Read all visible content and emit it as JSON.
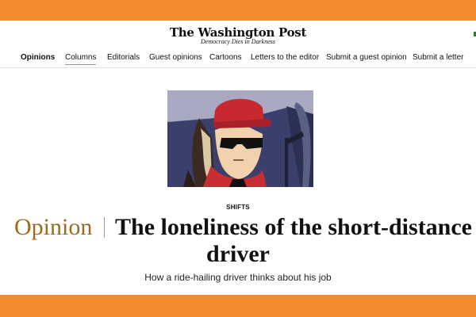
{
  "masthead": {
    "logo": "The Washington Post",
    "tagline": "Democracy Dies in Darkness"
  },
  "nav": {
    "items": [
      {
        "label": "Opinions"
      },
      {
        "label": "Columns"
      },
      {
        "label": "Editorials"
      },
      {
        "label": "Guest opinions"
      },
      {
        "label": "Cartoons"
      },
      {
        "label": "Letters to the editor"
      },
      {
        "label": "Submit a guest opinion"
      },
      {
        "label": "Submit a letter"
      }
    ]
  },
  "article": {
    "kicker": "SHIFTS",
    "section_label": "Opinion",
    "title_line1": "The loneliness of the short-distance",
    "title_line2": "driver",
    "dek": "How a ride-hailing driver thinks about his job"
  },
  "colors": {
    "band": "#f28a30",
    "opinion_label": "#9a6b1f"
  }
}
